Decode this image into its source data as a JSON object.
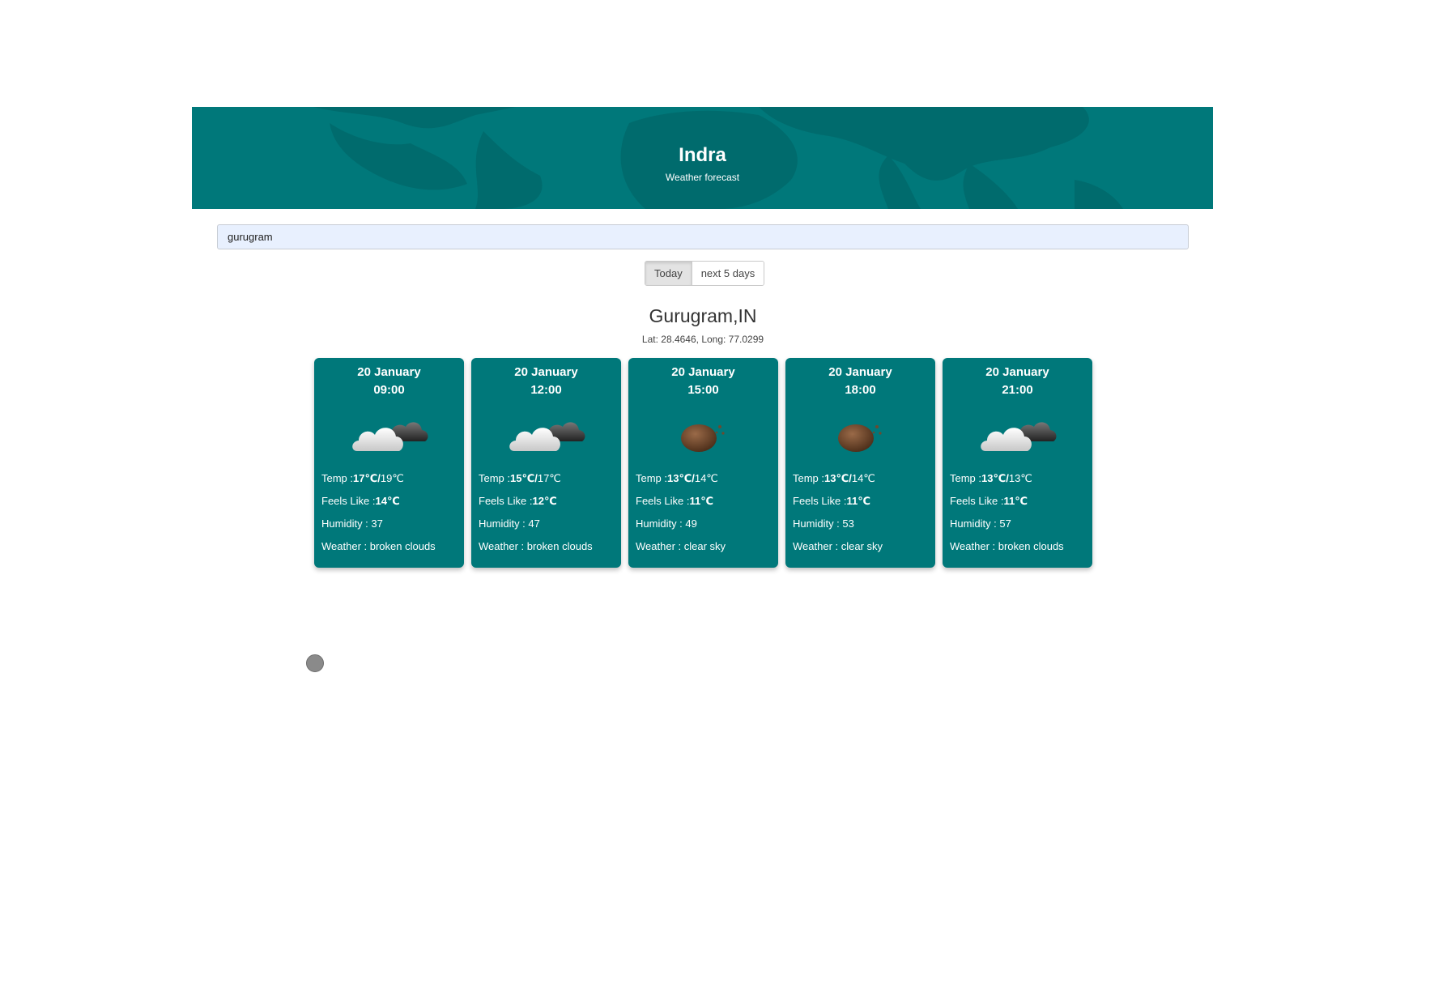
{
  "header": {
    "title": "Indra",
    "subtitle": "Weather forecast",
    "background_color": "#00787a"
  },
  "search": {
    "value": "gurugram"
  },
  "view_toggle": {
    "today_label": "Today",
    "next_label": "next 5 days",
    "selected": "Today"
  },
  "location": {
    "name": "Gurugram,IN",
    "coords": "Lat: 28.4646, Long: 77.0299"
  },
  "forecast": [
    {
      "date": "20 January",
      "time": "09:00",
      "icon": "broken-clouds-icon",
      "temp_label": "Temp :",
      "temp": "17℃",
      "temp_sep": "/",
      "temp_max": "19℃",
      "feels_label": "Feels Like :",
      "feels": "14℃",
      "humidity": "Humidity : 37",
      "weather": "Weather : broken clouds"
    },
    {
      "date": "20 January",
      "time": "12:00",
      "icon": "broken-clouds-icon",
      "temp_label": "Temp :",
      "temp": "15℃",
      "temp_sep": "/",
      "temp_max": "17℃",
      "feels_label": "Feels Like :",
      "feels": "12℃",
      "humidity": "Humidity : 47",
      "weather": "Weather : broken clouds"
    },
    {
      "date": "20 January",
      "time": "15:00",
      "icon": "clear-sky-icon",
      "temp_label": "Temp :",
      "temp": "13℃",
      "temp_sep": "/",
      "temp_max": "14℃",
      "feels_label": "Feels Like :",
      "feels": "11℃",
      "humidity": "Humidity : 49",
      "weather": "Weather : clear sky"
    },
    {
      "date": "20 January",
      "time": "18:00",
      "icon": "clear-sky-icon",
      "temp_label": "Temp :",
      "temp": "13℃",
      "temp_sep": "/",
      "temp_max": "14℃",
      "feels_label": "Feels Like :",
      "feels": "11℃",
      "humidity": "Humidity : 53",
      "weather": "Weather : clear sky"
    },
    {
      "date": "20 January",
      "time": "21:00",
      "icon": "broken-clouds-icon",
      "temp_label": "Temp :",
      "temp": "13℃",
      "temp_sep": "/",
      "temp_max": "13℃",
      "feels_label": "Feels Like :",
      "feels": "11℃",
      "humidity": "Humidity : 57",
      "weather": "Weather : broken clouds"
    }
  ]
}
